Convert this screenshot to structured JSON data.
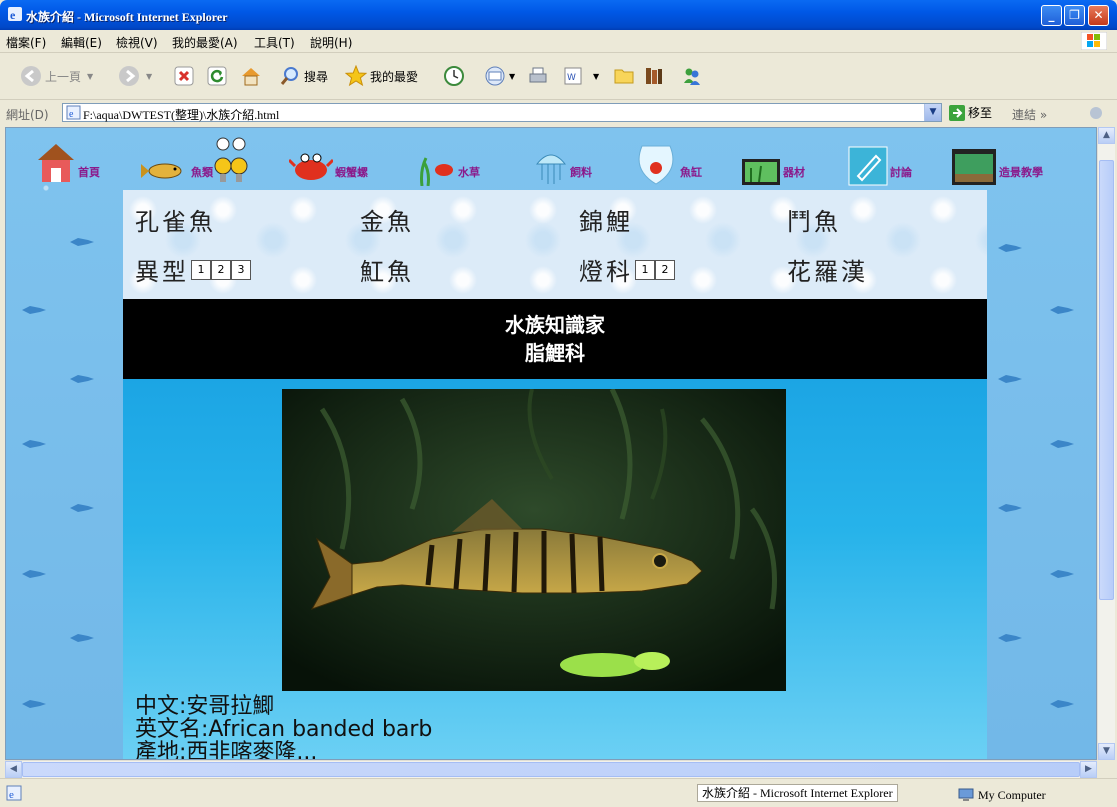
{
  "window": {
    "title": "水族介紹 - Microsoft Internet Explorer"
  },
  "menu": {
    "items": [
      "檔案(F)",
      "編輯(E)",
      "檢視(V)",
      "我的最愛(A)",
      "工具(T)",
      "說明(H)"
    ]
  },
  "toolbar": {
    "back_label": "上一頁",
    "search_label": "搜尋",
    "favorites_label": "我的最愛"
  },
  "address": {
    "label": "網址(D)",
    "url": "F:\\aqua\\DWTEST(整理)\\水族介紹.html",
    "go_label": "移至",
    "links_label": "連結"
  },
  "site_nav": {
    "items": [
      "首頁",
      "魚類",
      "蝦蟹螺",
      "水草",
      "飼料",
      "魚缸",
      "器材",
      "討論",
      "造景教學"
    ]
  },
  "fish_nav": {
    "row1": [
      "孔雀魚",
      "金魚",
      "錦鯉",
      "鬥魚"
    ],
    "row2": [
      "異型",
      "魟魚",
      "燈科",
      "花羅漢"
    ]
  },
  "page": {
    "heading": "水族知識家",
    "family": "脂鯉科",
    "chinese_name": "中文:安哥拉鯽",
    "english_name": "英文名:African banded barb",
    "origin_partial": "產地:西非喀麥隆..."
  },
  "status": {
    "tooltip": "水族介紹 - Microsoft Internet Explorer",
    "zone": "My Computer"
  },
  "colors": {
    "title_bar": "#0058E6",
    "page_bg": "#7FC3EE",
    "content_bg": "#1CA5E4",
    "heading_bg": "#000000"
  }
}
